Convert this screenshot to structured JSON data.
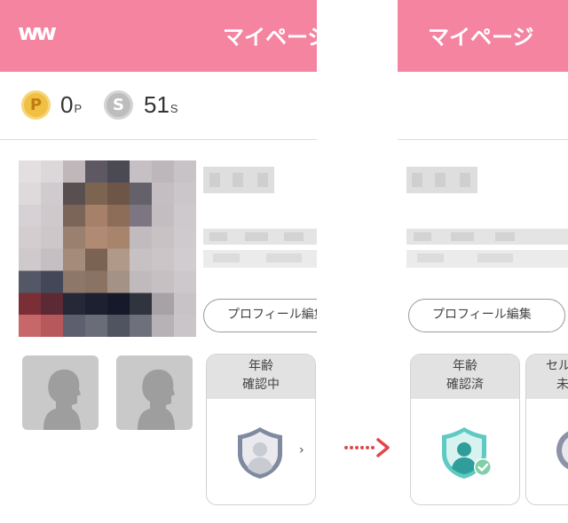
{
  "header": {
    "logo_text": "ww",
    "title": "マイページ",
    "background_color": "#f484a0"
  },
  "points": {
    "p_coin_label": "P",
    "p_value": "0",
    "p_unit": "P",
    "s_coin_label": "S",
    "s_value": "51",
    "s_unit": "S"
  },
  "profile": {
    "edit_button_label": "プロフィール編集"
  },
  "before": {
    "age_card_line1": "年齢",
    "age_card_line2": "確認中",
    "chevron": "›",
    "badge_status": "pending"
  },
  "after": {
    "age_card_line1": "年齢",
    "age_card_line2": "確認済",
    "next_card_line1": "セル",
    "next_card_line2": "未",
    "badge_status": "verified"
  },
  "icons": {
    "arrow": "dotted-arrow-right-icon",
    "badge_pending": "shield-user-gray-icon",
    "badge_verified": "shield-user-check-teal-icon"
  },
  "colors": {
    "accent_pink": "#f484a0",
    "coin_gold": "#f0c043",
    "coin_silver": "#bdbdbd",
    "verified_teal": "#5fc9c4",
    "arrow_red": "#e0474c"
  }
}
